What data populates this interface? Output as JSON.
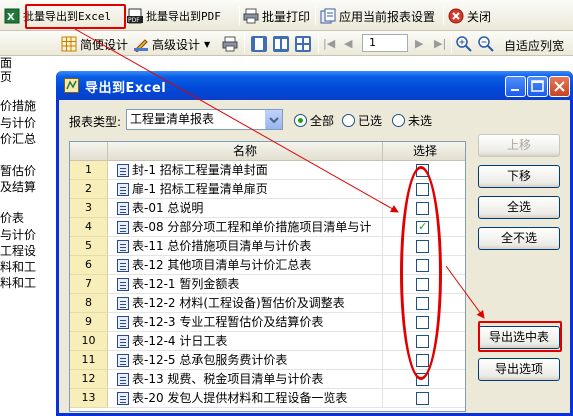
{
  "toolbar1": {
    "batch_export_excel": "批量导出到Excel",
    "batch_export_pdf": "批量导出到PDF",
    "batch_print": "批量打印",
    "apply_settings": "应用当前报表设置",
    "close": "关闭"
  },
  "toolbar2": {
    "simple_design": "简便设计",
    "advanced_design": "高级设计",
    "page_number": "1",
    "fit_width": "自适应列宽"
  },
  "left_panel": {
    "lines": [
      "面",
      "页",
      "价措施",
      "与计价",
      "价汇总",
      "暂估价",
      "及结算",
      "价表",
      "与计价",
      "工程设",
      "料和工",
      "料和工"
    ]
  },
  "dialog": {
    "title": "导出到Excel",
    "report_type_label": "报表类型:",
    "report_type_value": "工程量清单报表",
    "radio_all": "全部",
    "radio_selected": "已选",
    "radio_unselected": "未选",
    "radio_checked": "all",
    "columns": {
      "name": "名称",
      "select": "选择"
    },
    "rows": [
      {
        "num": "1",
        "name": "封-1 招标工程量清单封面",
        "checked": false
      },
      {
        "num": "2",
        "name": "扉-1 招标工程量清单扉页",
        "checked": false
      },
      {
        "num": "3",
        "name": "表-01 总说明",
        "checked": false
      },
      {
        "num": "4",
        "name": "表-08 分部分项工程和单价措施项目清单与计",
        "checked": true
      },
      {
        "num": "5",
        "name": "表-11 总价措施项目清单与计价表",
        "checked": false
      },
      {
        "num": "6",
        "name": "表-12 其他项目清单与计价汇总表",
        "checked": false
      },
      {
        "num": "7",
        "name": "表-12-1 暂列金额表",
        "checked": false
      },
      {
        "num": "8",
        "name": "表-12-2 材料(工程设备)暂估价及调整表",
        "checked": false
      },
      {
        "num": "9",
        "name": "表-12-3 专业工程暂估价及结算价表",
        "checked": false
      },
      {
        "num": "10",
        "name": "表-12-4 计日工表",
        "checked": false
      },
      {
        "num": "11",
        "name": "表-12-5 总承包服务费计价表",
        "checked": false
      },
      {
        "num": "12",
        "name": "表-13 规费、税金项目清单与计价表",
        "checked": false
      },
      {
        "num": "13",
        "name": "表-20 发包人提供材料和工程设备一览表",
        "checked": false
      }
    ],
    "buttons": {
      "move_up": "上移",
      "move_down": "下移",
      "select_all": "全选",
      "deselect_all": "全不选",
      "export_selected": "导出选中表",
      "export_option": "导出选项"
    }
  },
  "colors": {
    "title_blue": "#0a5fe6",
    "annotation_red": "#e00000",
    "row_number_bg": "#f7eeb9",
    "check_green": "#21a121"
  }
}
